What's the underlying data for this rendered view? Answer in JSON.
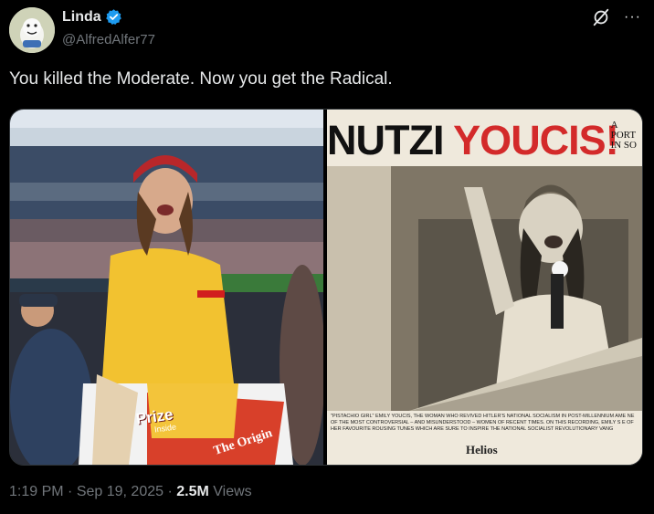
{
  "author": {
    "display_name": "Linda",
    "handle": "@AlfredAlfer77",
    "verified_icon": "verified-badge-icon",
    "avatar_icon": "avatar-cartoon-icon"
  },
  "top_actions": {
    "grok_icon": "grok-icon",
    "more_icon": "more-icon",
    "more_glyph": "···"
  },
  "tweet": {
    "text": "You killed the Moderate. Now you get the Radical."
  },
  "media": {
    "left_photo": {
      "description_icon": "stadium-photo",
      "bag_text_1": "Prize",
      "bag_text_2": "Inside",
      "bag_text_3": "The Origin"
    },
    "right_photo": {
      "title_black": "NUTZI ",
      "title_red": "YOUCIS!",
      "corner_line1": "A",
      "corner_line2": "PORT",
      "corner_line3": "IN SO",
      "caption": "\"PISTACHIO GIRL\" EMILY YOUCIS, THE WOMAN WHO REVIVED HITLER'S NATIONAL SOCIALISM IN POST-MILLENNIUM AME NE OF THE MOST CONTROVERSIAL – AND MISUNDERSTOOD – WOMEN OF RECENT TIMES. ON THIS RECORDING, EMILY S E OF HER FAVOURITE ROUSING TUNES WHICH ARE SURE TO INSPIRE THE NATIONAL SOCIALIST REVOLUTIONARY VANG",
      "logo": "Helios"
    }
  },
  "meta": {
    "time": "1:19 PM",
    "sep1": " · ",
    "date": "Sep 19, 2025",
    "sep2": " · ",
    "views_count": "2.5M",
    "views_label": " Views"
  },
  "colors": {
    "background": "#000000",
    "text": "#e7e9ea",
    "secondary": "#71767b",
    "verified": "#1d9bf0",
    "poster_red": "#d32a2a"
  }
}
